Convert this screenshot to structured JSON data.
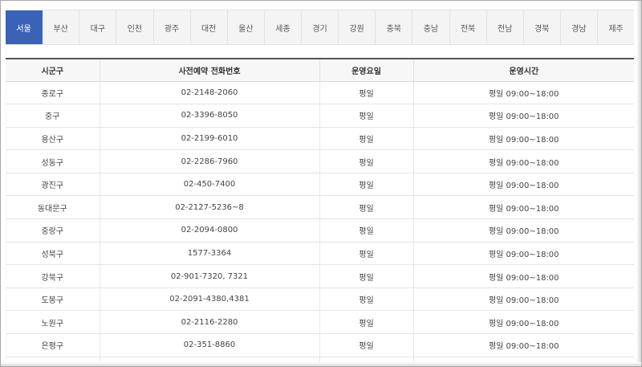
{
  "tabs": [
    {
      "label": "서울",
      "active": true
    },
    {
      "label": "부산",
      "active": false
    },
    {
      "label": "대구",
      "active": false
    },
    {
      "label": "인천",
      "active": false
    },
    {
      "label": "광주",
      "active": false
    },
    {
      "label": "대전",
      "active": false
    },
    {
      "label": "울산",
      "active": false
    },
    {
      "label": "세종",
      "active": false
    },
    {
      "label": "경기",
      "active": false
    },
    {
      "label": "강원",
      "active": false
    },
    {
      "label": "충북",
      "active": false
    },
    {
      "label": "충남",
      "active": false
    },
    {
      "label": "전북",
      "active": false
    },
    {
      "label": "전남",
      "active": false
    },
    {
      "label": "경북",
      "active": false
    },
    {
      "label": "경남",
      "active": false
    },
    {
      "label": "제주",
      "active": false
    }
  ],
  "table": {
    "headers": [
      "시군구",
      "사전예약 전화번호",
      "운영요일",
      "운영시간"
    ],
    "rows": [
      [
        "종로구",
        "02-2148-2060",
        "평일",
        "평일 09:00~18:00"
      ],
      [
        "중구",
        "02-3396-8050",
        "평일",
        "평일 09:00~18:00"
      ],
      [
        "용산구",
        "02-2199-6010",
        "평일",
        "평일 09:00~18:00"
      ],
      [
        "성동구",
        "02-2286-7960",
        "평일",
        "평일 09:00~18:00"
      ],
      [
        "광진구",
        "02-450-7400",
        "평일",
        "평일 09:00~18:00"
      ],
      [
        "동대문구",
        "02-2127-5236~8",
        "평일",
        "평일 09:00~18:00"
      ],
      [
        "중랑구",
        "02-2094-0800",
        "평일",
        "평일 09:00~18:00"
      ],
      [
        "성북구",
        "1577-3364",
        "평일",
        "평일 09:00~18:00"
      ],
      [
        "강북구",
        "02-901-7320, 7321",
        "평일",
        "평일 09:00~18:00"
      ],
      [
        "도봉구",
        "02-2091-4380,4381",
        "평일",
        "평일 09:00~18:00"
      ],
      [
        "노원구",
        "02-2116-2280",
        "평일",
        "평일 09:00~18:00"
      ],
      [
        "은평구",
        "02-351-8860",
        "평일",
        "평일 09:00~18:00"
      ],
      [
        "",
        "",
        "",
        ""
      ]
    ]
  },
  "colors": {
    "active_tab": "#3a63b8"
  }
}
